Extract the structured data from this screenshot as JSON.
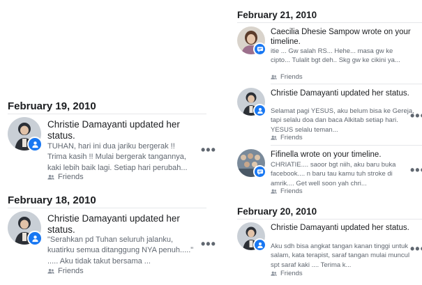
{
  "left": {
    "sections": [
      {
        "date": "February 19, 2010",
        "entry": {
          "title": "Christie Damayanti updated her status.",
          "snippet": "TUHAN, hari ini dua jariku bergerak !! Trima kasih !! Mulai bergerak tangannya, kaki lebih baik lagi. Setiap hari perubah...",
          "audience": "Friends",
          "more": "•••",
          "avatar_icon": "person-icon"
        }
      },
      {
        "date": "February 18, 2010",
        "entry": {
          "title": "Christie Damayanti updated her status.",
          "snippet": "\"Serahkan pd Tuhan seluruh jalanku, kuatirku semua ditanggung NYA penuh.....\" ..... Aku tidak takut bersama ...",
          "audience": "Friends",
          "more": "•••",
          "avatar_icon": "person-icon"
        }
      }
    ]
  },
  "right": {
    "sections": [
      {
        "date": "February 21, 2010",
        "entries": [
          {
            "title": "Caecilia Dhesie Sampow wrote on your timeline.",
            "snippet": "itie ... Gw salah RS... Hehe... masa gw ke cipto... Tulalit bgt deh.. Skg gw ke cikini ya...",
            "audience": "Friends",
            "avatar_icon": "message-icon"
          },
          {
            "title": "Christie Damayanti updated her status.",
            "snippet": "Selamat pagi YESUS, aku belum bisa ke Gereja, tapi selalu doa dan baca Alkitab setiap hari. YESUS selalu teman...",
            "audience": "Friends",
            "more": "•••",
            "avatar_icon": "person-icon"
          },
          {
            "title": "Fifinella wrote on your timeline.",
            "snippet": "CHRIATIE.... saoor bgt niih, aku baru buka facebook.... n baru tau kamu tuh stroke di amrik.... Get well soon yah chri...",
            "audience": "Friends",
            "more": "•••",
            "avatar_icon": "message-icon"
          }
        ]
      },
      {
        "date": "February 20, 2010",
        "entries": [
          {
            "title": "Christie Damayanti updated her status.",
            "snippet": "Aku sdh bisa angkat tangan kanan tinggi untuk salam, kata terapist, saraf tangan mulai muncul spt saraf kaki .... Terima k...",
            "audience": "Friends",
            "more": "•••",
            "avatar_icon": "person-icon"
          }
        ]
      }
    ]
  },
  "colors": {
    "badge": "#1877f2",
    "secondary_text": "#606770",
    "primary_text": "#1c1e21"
  }
}
